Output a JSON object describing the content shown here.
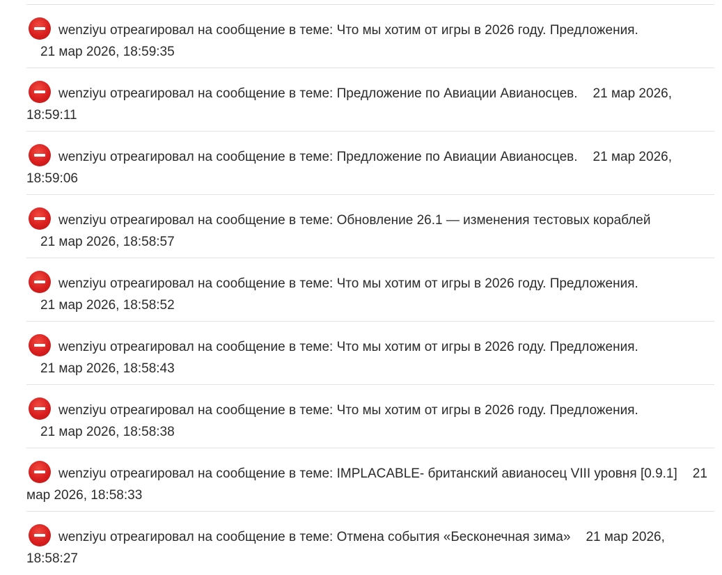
{
  "feed": {
    "items": [
      {
        "user": "wenziyu",
        "action": "отреагировал на сообщение в теме:",
        "topic": "Что мы хотим от игры в 2026 году. Предложения.",
        "timestamp": "21 мар 2026, 18:59:35",
        "icon": "minus-reaction-icon",
        "icon_color": "#d91f1f"
      },
      {
        "user": "wenziyu",
        "action": "отреагировал на сообщение в теме:",
        "topic": "Предложение по Авиации Авианосцев.",
        "timestamp": "21 мар 2026, 18:59:11",
        "icon": "minus-reaction-icon",
        "icon_color": "#d91f1f"
      },
      {
        "user": "wenziyu",
        "action": "отреагировал на сообщение в теме:",
        "topic": "Предложение по Авиации Авианосцев.",
        "timestamp": "21 мар 2026, 18:59:06",
        "icon": "minus-reaction-icon",
        "icon_color": "#d91f1f"
      },
      {
        "user": "wenziyu",
        "action": "отреагировал на сообщение в теме:",
        "topic": "Обновление 26.1 — изменения тестовых кораблей",
        "timestamp": "21 мар 2026, 18:58:57",
        "icon": "minus-reaction-icon",
        "icon_color": "#d91f1f"
      },
      {
        "user": "wenziyu",
        "action": "отреагировал на сообщение в теме:",
        "topic": "Что мы хотим от игры в 2026 году. Предложения.",
        "timestamp": "21 мар 2026, 18:58:52",
        "icon": "minus-reaction-icon",
        "icon_color": "#d91f1f"
      },
      {
        "user": "wenziyu",
        "action": "отреагировал на сообщение в теме:",
        "topic": "Что мы хотим от игры в 2026 году. Предложения.",
        "timestamp": "21 мар 2026, 18:58:43",
        "icon": "minus-reaction-icon",
        "icon_color": "#d91f1f"
      },
      {
        "user": "wenziyu",
        "action": "отреагировал на сообщение в теме:",
        "topic": "Что мы хотим от игры в 2026 году. Предложения.",
        "timestamp": "21 мар 2026, 18:58:38",
        "icon": "minus-reaction-icon",
        "icon_color": "#d91f1f"
      },
      {
        "user": "wenziyu",
        "action": "отреагировал на сообщение в теме:",
        "topic": "IMPLACABLE- британский авианосец VIII уровня [0.9.1]",
        "timestamp": "21 мар 2026, 18:58:33",
        "icon": "minus-reaction-icon",
        "icon_color": "#d91f1f"
      },
      {
        "user": "wenziyu",
        "action": "отреагировал на сообщение в теме:",
        "topic": "Отмена события «Бесконечная зима»",
        "timestamp": "21 мар 2026, 18:58:27",
        "icon": "minus-reaction-icon",
        "icon_color": "#d91f1f"
      }
    ]
  }
}
